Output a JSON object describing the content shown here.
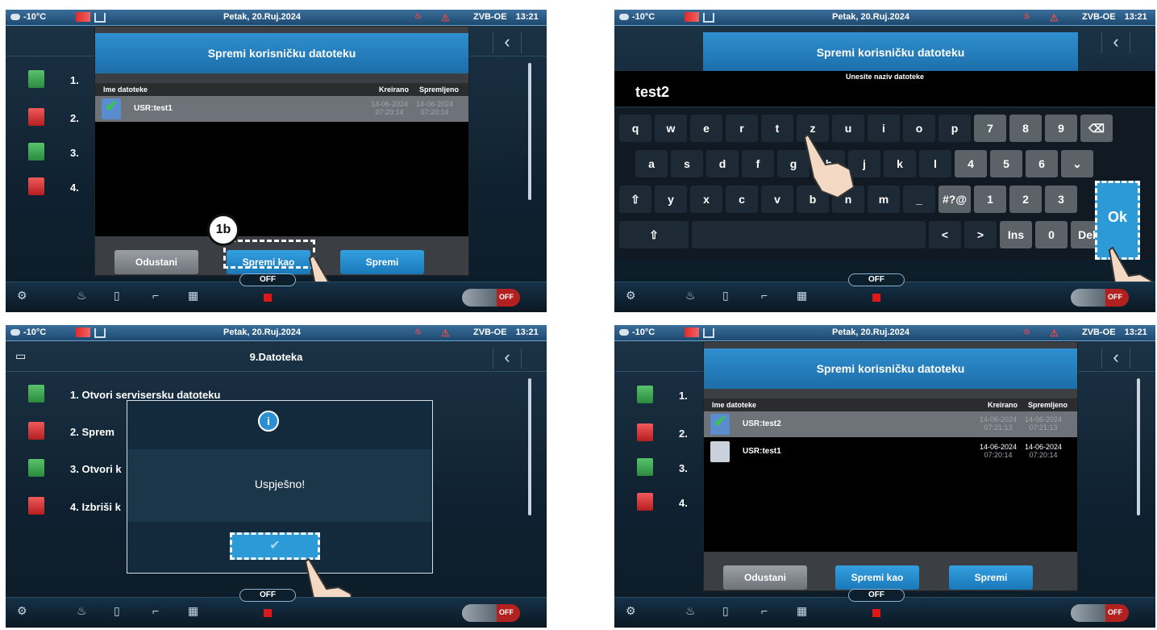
{
  "topbar": {
    "temp": "-10°C",
    "date": "Petak, 20.Ruj.2024",
    "id": "ZVB-OE",
    "time": "13:21"
  },
  "panel1": {
    "dialog_title": "Spremi korisničku datoteku",
    "head_name": "Ime datoteke",
    "head_created": "Kreirano",
    "head_saved": "Spremljeno",
    "files": [
      {
        "name": "USR:test1",
        "created": "14-06-2024",
        "created_time": "07:20:14",
        "saved": "14-06-2024",
        "saved_time": "07:20:14"
      }
    ],
    "btn_cancel": "Odustani",
    "btn_saveas": "Spremi kao",
    "btn_save": "Spremi",
    "badge": "1b"
  },
  "panel2": {
    "dialog_title": "Spremi korisničku datoteku",
    "prompt": "Unesite naziv datoteke",
    "input_value": "test2",
    "rows": [
      [
        "q",
        "w",
        "e",
        "r",
        "t",
        "z",
        "u",
        "i",
        "o",
        "p",
        "7",
        "8",
        "9",
        "⌫"
      ],
      [
        "a",
        "s",
        "d",
        "f",
        "g",
        "h",
        "j",
        "k",
        "l",
        "4",
        "5",
        "6",
        "⌄"
      ],
      [
        "⇧",
        "y",
        "x",
        "c",
        "v",
        "b",
        "n",
        "m",
        "_",
        "#?@",
        "1",
        "2",
        "3"
      ],
      [
        "⇧",
        "",
        "<",
        ">",
        "Ins",
        "0",
        "Del"
      ]
    ],
    "ok": "Ok"
  },
  "panel3": {
    "header": "9.Datoteka",
    "items": [
      "1. Otvori servisersku datoteku",
      "2. Sprem",
      "3. Otvori k",
      "4. Izbriši k"
    ],
    "message": "Uspješno!"
  },
  "panel4": {
    "dialog_title": "Spremi korisničku datoteku",
    "head_name": "Ime datoteke",
    "head_created": "Kreirano",
    "head_saved": "Spremljeno",
    "files": [
      {
        "name": "USR:test2",
        "created": "14-06-2024",
        "created_time": "07:21:13",
        "saved": "14-06-2024",
        "saved_time": "07:21:13"
      },
      {
        "name": "USR:test1",
        "created": "14-06-2024",
        "created_time": "07:20:14",
        "saved": "14-06-2024",
        "saved_time": "07:20:14"
      }
    ],
    "btn_cancel": "Odustani",
    "btn_saveas": "Spremi kao",
    "btn_save": "Spremi"
  },
  "bottombar": {
    "off_label": "OFF",
    "toggle_label": "OFF"
  },
  "menu_items_bg": [
    "1.",
    "2.",
    "3.",
    "4."
  ]
}
